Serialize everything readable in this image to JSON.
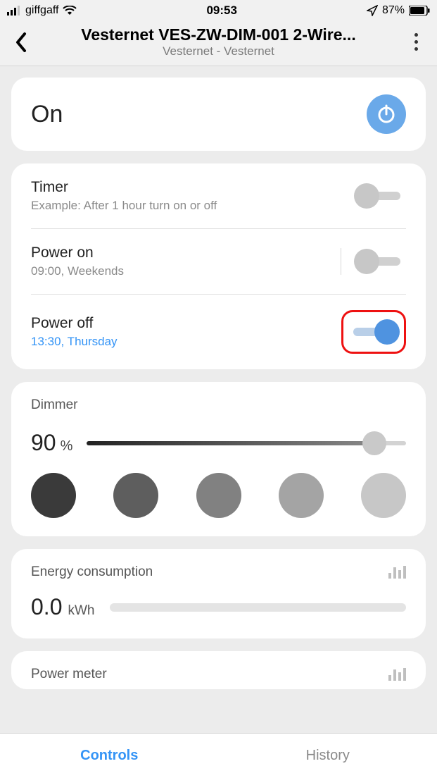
{
  "status": {
    "carrier": "giffgaff",
    "time": "09:53",
    "battery": "87%"
  },
  "header": {
    "title": "Vesternet VES-ZW-DIM-001 2-Wire...",
    "subtitle": "Vesternet - Vesternet"
  },
  "power": {
    "state": "On"
  },
  "schedules": [
    {
      "title": "Timer",
      "subtitle": "Example: After 1 hour turn on or off",
      "on": false,
      "divider": false,
      "highlight": false,
      "active": false
    },
    {
      "title": "Power on",
      "subtitle": "09:00, Weekends",
      "on": false,
      "divider": true,
      "highlight": false,
      "active": false
    },
    {
      "title": "Power off",
      "subtitle": "13:30, Thursday",
      "on": true,
      "divider": false,
      "highlight": true,
      "active": true
    }
  ],
  "dimmer": {
    "label": "Dimmer",
    "value": "90",
    "unit": "%",
    "percent": 90,
    "presets": [
      "#3a3a3a",
      "#5e5e5e",
      "#818181",
      "#a4a4a4",
      "#c7c7c7"
    ]
  },
  "energy": {
    "title": "Energy consumption",
    "value": "0.0",
    "unit": "kWh"
  },
  "meter": {
    "title": "Power meter"
  },
  "tabs": {
    "controls": "Controls",
    "history": "History"
  }
}
